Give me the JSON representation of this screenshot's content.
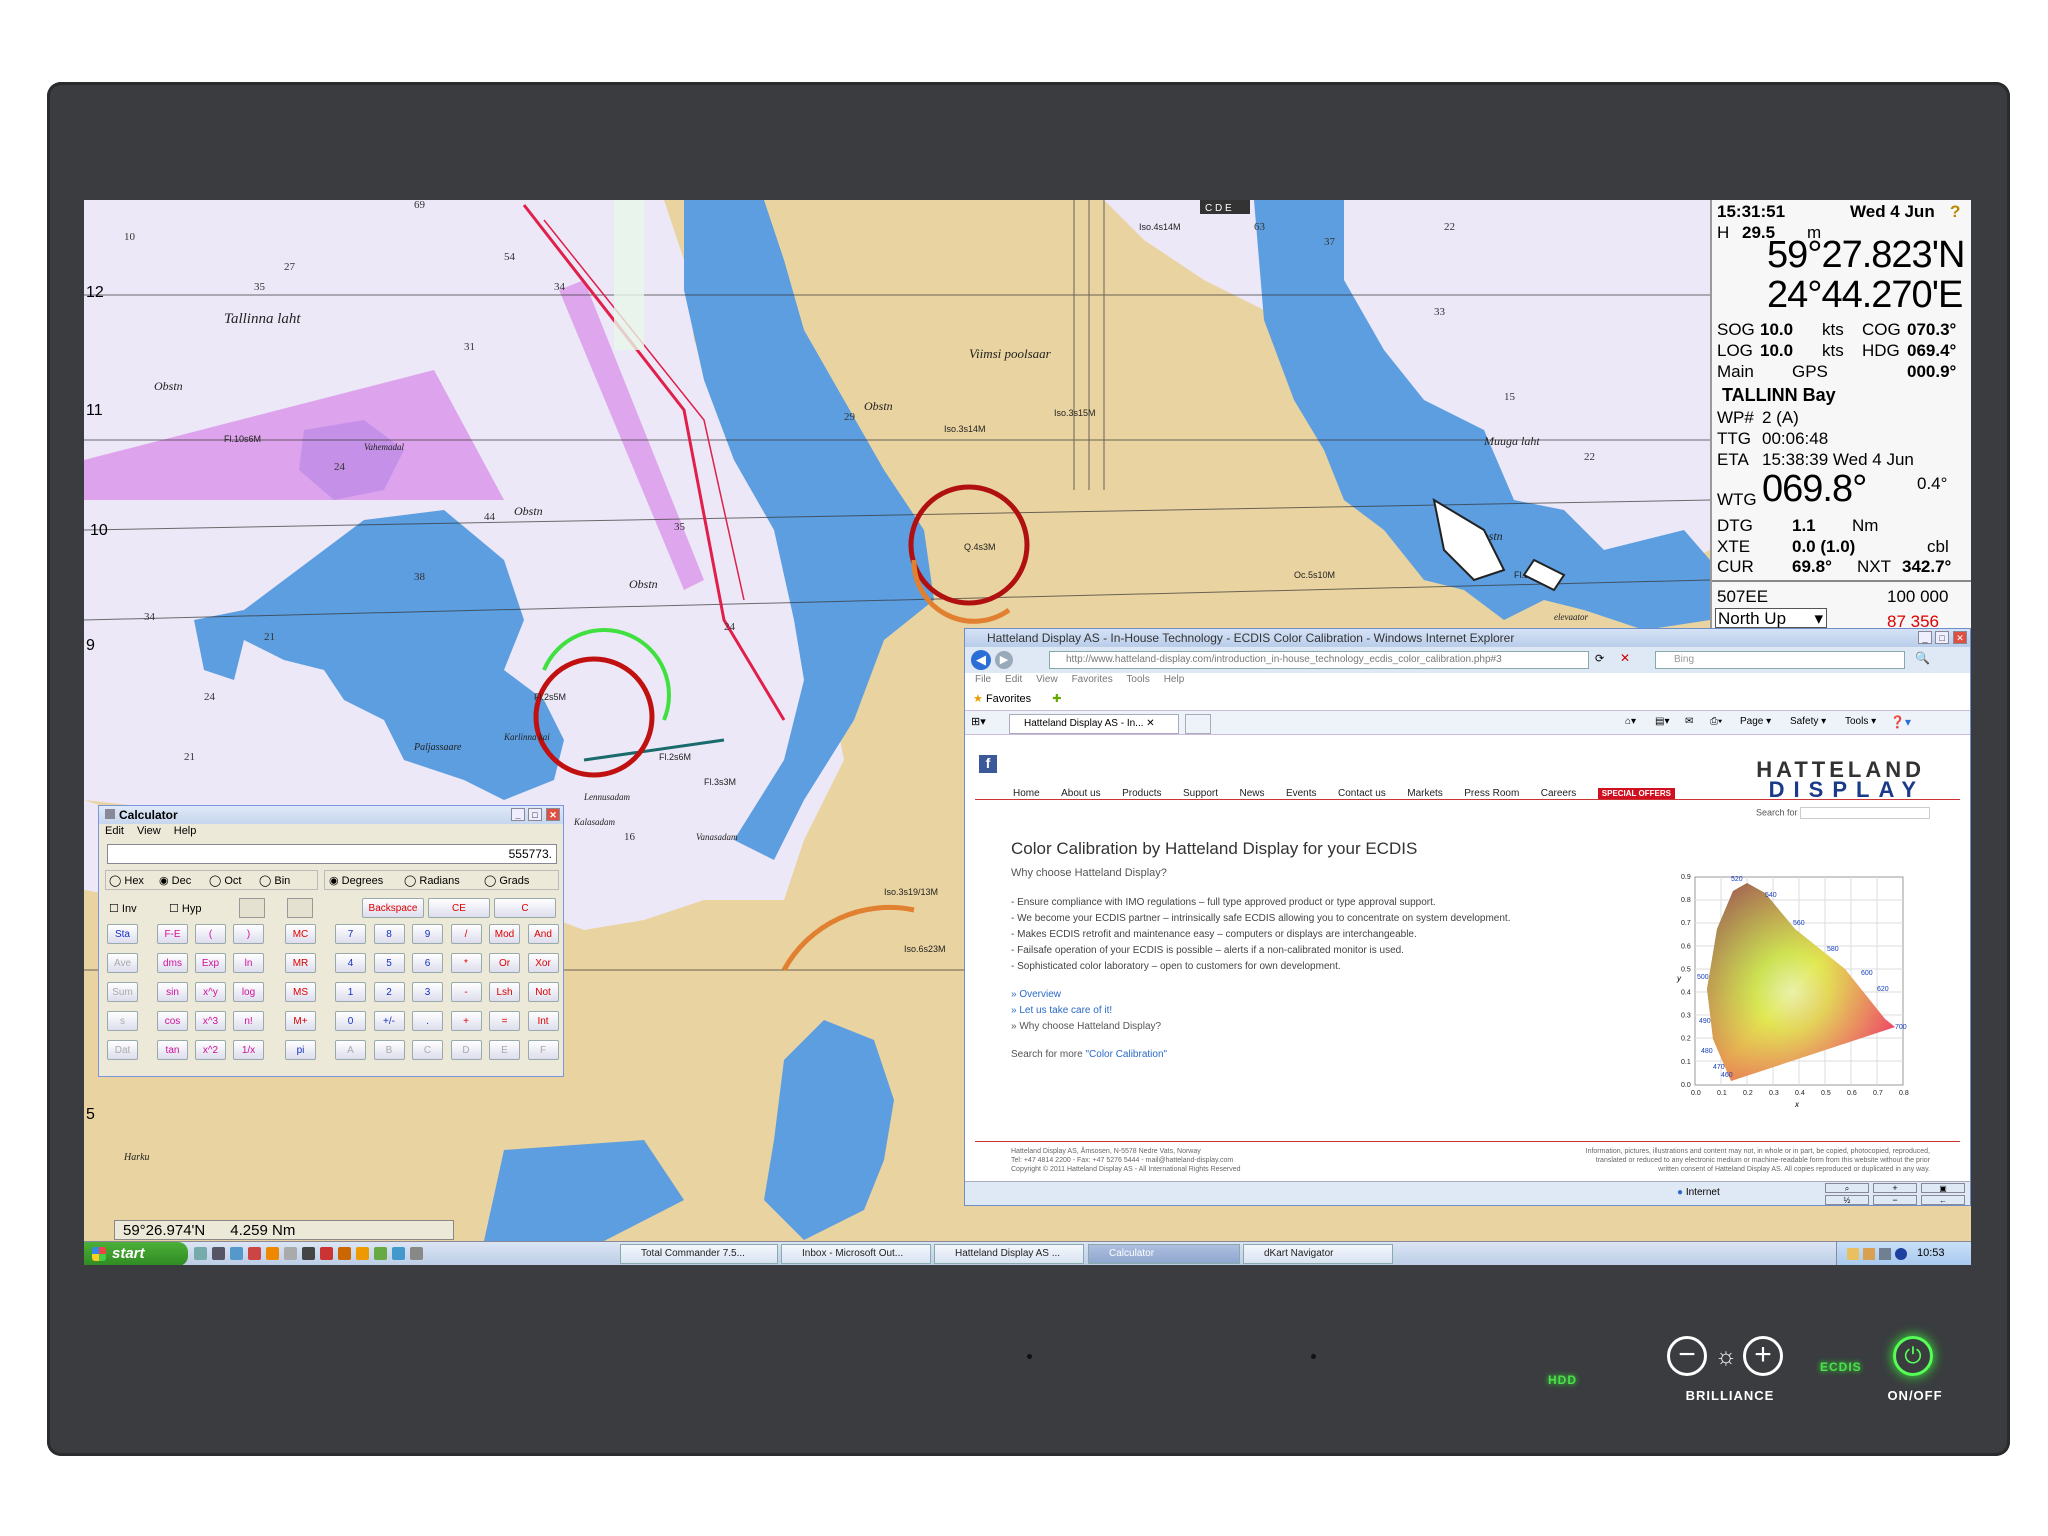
{
  "info_panel": {
    "time": "15:31:51",
    "date": "Wed 4 Jun",
    "h_label": "H",
    "h_value": "29.5",
    "h_unit": "m",
    "lat": "59°27.823'N",
    "lon": "24°44.270'E",
    "sog_label": "SOG",
    "sog_value": "10.0",
    "sog_unit": "kts",
    "cog_label": "COG",
    "cog_value": "070.3°",
    "log_label": "LOG",
    "log_value": "10.0",
    "log_unit": "kts",
    "hdg_label": "HDG",
    "hdg_value": "069.4°",
    "main_label": "Main",
    "gps_label": "GPS",
    "gps_value": "000.9°",
    "route_name": "TALLINN Bay",
    "wp_label": "WP#",
    "wp_value": "2  (A)",
    "ttg_label": "TTG",
    "ttg_value": "00:06:48",
    "eta_label": "ETA",
    "eta_value": "15:38:39 Wed 4 Jun",
    "wtg_label": "WTG",
    "wtg_value": "069.8°",
    "wtg_extra": "0.4°",
    "dtg_label": "DTG",
    "dtg_value": "1.1",
    "dtg_unit": "Nm",
    "xte_label": "XTE",
    "xte_value": "0.0 (1.0)",
    "xte_unit": "cbl",
    "cur_label": "CUR",
    "cur_value": "69.8°",
    "nxt_label": "NXT",
    "nxt_value": "342.7°",
    "chart_id": "507EE",
    "scale": "100 000",
    "orientation": "North Up",
    "partial_value": "87 356"
  },
  "chart": {
    "cursor_lat": "59°26.974'N",
    "cursor_range": "4.259  Nm",
    "place_labels": [
      "Tallinna laht",
      "Viimsi poolsaar",
      "Muuga laht",
      "Obstn",
      "Harku",
      "Paljassaare",
      "Karlinna kai",
      "Vanasadam",
      "Vahemadal",
      "elevaator",
      "Kalasadam",
      "Lennusadam",
      "Pirita"
    ],
    "light_labels": [
      "Iso.3s14M",
      "Iso.3s15M",
      "Q.4s3M",
      "Fl.2s5M",
      "Fl.3s3M",
      "Fl.2s6M",
      "Iso.3s19/13M",
      "Iso.6s23M",
      "Iso.4s14M",
      "Oc.5s10M",
      "Fl.3s",
      "Fl.10s6M"
    ],
    "latitude_ticks": [
      "12",
      "11",
      "10",
      "9",
      "5"
    ],
    "toolbar_letters": "C D E"
  },
  "calculator": {
    "title": "Calculator",
    "menu": [
      "Edit",
      "View",
      "Help"
    ],
    "display": "555773.",
    "base_options": [
      "Hex",
      "Dec",
      "Oct",
      "Bin"
    ],
    "angle_options": [
      "Degrees",
      "Radians",
      "Grads"
    ],
    "inv": "Inv",
    "hyp": "Hyp",
    "backspace": "Backspace",
    "ce": "CE",
    "c": "C",
    "left_col": [
      "Sta",
      "Ave",
      "Sum",
      "s",
      "Dat"
    ],
    "fn_rows": [
      [
        "F-E",
        "(",
        ")"
      ],
      [
        "dms",
        "Exp",
        "ln"
      ],
      [
        "sin",
        "x^y",
        "log"
      ],
      [
        "cos",
        "x^3",
        "n!"
      ],
      [
        "tan",
        "x^2",
        "1/x"
      ]
    ],
    "mem": [
      "MC",
      "MR",
      "MS",
      "M+",
      "pi"
    ],
    "num_rows": [
      [
        "7",
        "8",
        "9",
        "/",
        "Mod",
        "And"
      ],
      [
        "4",
        "5",
        "6",
        "*",
        "Or",
        "Xor"
      ],
      [
        "1",
        "2",
        "3",
        "-",
        "Lsh",
        "Not"
      ],
      [
        "0",
        "+/-",
        ".",
        "+",
        "=",
        "Int"
      ],
      [
        "A",
        "B",
        "C",
        "D",
        "E",
        "F"
      ]
    ]
  },
  "browser": {
    "title": "Hatteland Display AS - In-House Technology - ECDIS Color Calibration - Windows Internet Explorer",
    "url": "http://www.hatteland-display.com/introduction_in-house_technology_ecdis_color_calibration.php#3",
    "search_engine": "Bing",
    "menu": [
      "File",
      "Edit",
      "View",
      "Favorites",
      "Tools",
      "Help"
    ],
    "favorites": "Favorites",
    "tab": "Hatteland Display AS - In...",
    "cmd": [
      "Page ▾",
      "Safety ▾",
      "Tools ▾"
    ],
    "status_zone": "Internet",
    "site": {
      "nav": [
        "Home",
        "About us",
        "Products",
        "Support",
        "News",
        "Events",
        "Contact us",
        "Markets",
        "Press Room",
        "Careers"
      ],
      "special": "SPECIAL OFFERS",
      "logo_top": "HATTELAND",
      "logo_bottom": "DISPLAY",
      "search_label": "Search for",
      "heading": "Color Calibration by Hatteland Display for your ECDIS",
      "subheading": "Why choose Hatteland Display?",
      "bullets": [
        "- Ensure compliance with IMO regulations – full type approved product or type approval support.",
        "- We become your ECDIS partner – intrinsically safe ECDIS allowing you to concentrate on system development.",
        "- Makes ECDIS retrofit and maintenance easy – computers or displays are interchangeable.",
        "- Failsafe operation of your ECDIS is possible – alerts if a non-calibrated monitor is used.",
        "- Sophisticated color laboratory – open to customers for own development."
      ],
      "links": [
        "» Overview",
        "» Let us take care of it!",
        "» Why choose Hatteland Display?"
      ],
      "search_more": "Search for more",
      "search_more_link": "\"Color Calibration\"",
      "footer_left": [
        "Hatteland Display AS, Åmsosen, N-5578 Nedre Vats, Norway",
        "Tel: +47 4814 2200 - Fax: +47 5276 5444 - mail@hatteland-display.com",
        "Copyright © 2011 Hatteland Display AS - All International Rights Reserved"
      ],
      "footer_right": [
        "Information, pictures, illustrations and content may not, in whole or in part, be copied, photocopied, reproduced,",
        "translated or reduced to any electronic medium or machine-readable form from this website without the prior",
        "written consent of Hatteland Display AS. All copies reproduced or duplicated in any way."
      ],
      "cie_y_ticks": [
        "0.9",
        "0.8",
        "0.7",
        "0.6",
        "0.5",
        "0.4",
        "0.3",
        "0.2",
        "0.1",
        "0.0"
      ],
      "cie_x_ticks": [
        "0.0",
        "0.1",
        "0.2",
        "0.3",
        "0.4",
        "0.5",
        "0.6",
        "0.7",
        "0.8"
      ],
      "cie_x_label": "x",
      "cie_y_label": "y",
      "cie_wavelengths": [
        "520",
        "540",
        "560",
        "580",
        "600",
        "620",
        "700",
        "500",
        "490",
        "480",
        "470",
        "460"
      ]
    }
  },
  "taskbar": {
    "start": "start",
    "tasks": [
      "Total Commander 7.5...",
      "Inbox - Microsoft Out...",
      "Hatteland Display AS ...",
      "Calculator",
      "dKart Navigator"
    ],
    "clock": "10:53"
  },
  "bezel": {
    "hdd": "HDD",
    "brilliance": "BRILLIANCE",
    "ecdis": "ECDIS",
    "onoff": "ON/OFF"
  },
  "colors": {
    "land": "#e9d3a0",
    "deep_water": "#ece8f7",
    "shallow_water": "#5c9ee0",
    "route": "#e0204a",
    "magenta_zone": "#d88ce8",
    "bezel": "#3a3c3f"
  }
}
